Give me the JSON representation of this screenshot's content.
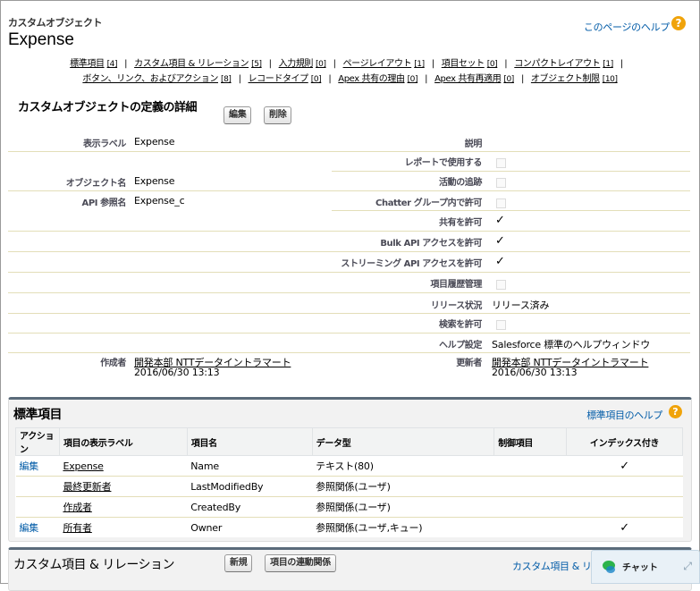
{
  "header": {
    "breadcrumb": "カスタムオブジェクト",
    "title": "Expense",
    "help_link": "このページのヘルプ",
    "help_icon": "?"
  },
  "nav": {
    "row1": [
      {
        "label": "標準項目",
        "count": "[4]"
      },
      {
        "label": "カスタム項目 & リレーション",
        "count": "[5]"
      },
      {
        "label": "入力規則",
        "count": "[0]"
      },
      {
        "label": "ページレイアウト",
        "count": "[1]"
      },
      {
        "label": "項目セット",
        "count": "[0]"
      },
      {
        "label": "コンパクトレイアウト",
        "count": "[1]"
      }
    ],
    "row2": [
      {
        "label": "ボタン、リンク、およびアクション",
        "count": "[8]"
      },
      {
        "label": "レコードタイプ",
        "count": "[0]"
      },
      {
        "label": "Apex 共有の理由",
        "count": "[0]"
      },
      {
        "label": "Apex 共有再適用",
        "count": "[0]"
      },
      {
        "label": "オブジェクト制限",
        "count": "[10]"
      }
    ]
  },
  "detail": {
    "title": "カスタムオブジェクトの定義の詳細",
    "edit_button": "編集",
    "delete_button": "削除",
    "fields": {
      "display_label": {
        "label": "表示ラベル",
        "value": "Expense"
      },
      "object_name": {
        "label": "オブジェクト名",
        "value": "Expense"
      },
      "api_name": {
        "label": "API 参照名",
        "value": "Expense_c"
      },
      "description": {
        "label": "説明",
        "value": ""
      },
      "allow_reports": {
        "label": "レポートで使用する"
      },
      "track_activities": {
        "label": "活動の追跡"
      },
      "allow_chatter_groups": {
        "label": "Chatter グループ内で許可"
      },
      "allow_sharing": {
        "label": "共有を許可"
      },
      "allow_bulk_api": {
        "label": "Bulk API アクセスを許可"
      },
      "allow_streaming_api": {
        "label": "ストリーミング API アクセスを許可"
      },
      "track_field_history": {
        "label": "項目履歴管理"
      },
      "deployment_status": {
        "label": "リリース状況",
        "value": "リリース済み"
      },
      "allow_search": {
        "label": "検索を許可"
      },
      "help_setting": {
        "label": "ヘルプ設定",
        "value": "Salesforce 標準のヘルプウィンドウ"
      },
      "created_by": {
        "label": "作成者",
        "user": "開発本部 NTTデータイントラマート",
        "date": "2016/06/30 13:13"
      },
      "modified_by": {
        "label": "更新者",
        "user": "開発本部 NTTデータイントラマート",
        "date": "2016/06/30 13:13"
      }
    },
    "check_mark": "✓"
  },
  "standard_fields": {
    "title": "標準項目",
    "help_link": "標準項目のヘルプ",
    "columns": [
      "アクション",
      "項目の表示ラベル",
      "項目名",
      "データ型",
      "制御項目",
      "インデックス付き"
    ],
    "rows": [
      {
        "action": "編集",
        "label": "Expense",
        "name": "Name",
        "type": "テキスト(80)",
        "controlling": "",
        "indexed": "✓"
      },
      {
        "action": "",
        "label": "最終更新者",
        "name": "LastModifiedBy",
        "type": "参照関係(ユーザ)",
        "controlling": "",
        "indexed": ""
      },
      {
        "action": "",
        "label": "作成者",
        "name": "CreatedBy",
        "type": "参照関係(ユーザ)",
        "controlling": "",
        "indexed": ""
      },
      {
        "action": "編集",
        "label": "所有者",
        "name": "Owner",
        "type": "参照関係(ユーザ,キュー)",
        "controlling": "",
        "indexed": "✓"
      }
    ]
  },
  "custom_fields": {
    "title": "カスタム項目 & リレーション",
    "new_button": "新規",
    "dependencies_button": "項目の連動関係",
    "help_link": "カスタム項目 & リレ"
  },
  "chat": {
    "label": "チャット",
    "icon": "chat-bubbles-icon"
  }
}
